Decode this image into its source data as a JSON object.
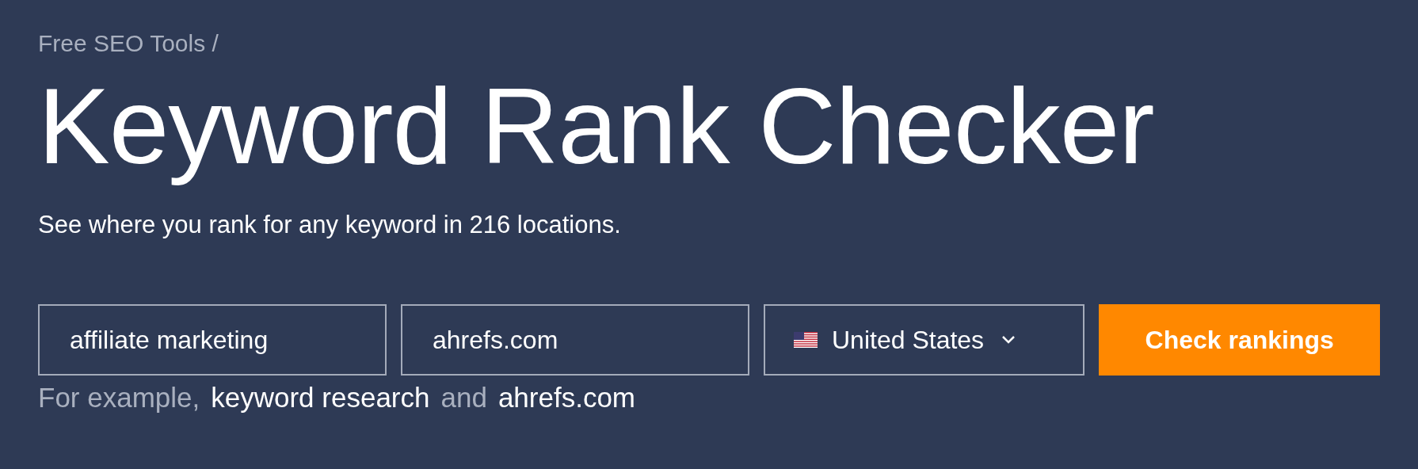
{
  "breadcrumb": "Free SEO Tools /",
  "title": "Keyword Rank Checker",
  "subtitle": "See where you rank for any keyword in 216 locations.",
  "form": {
    "keyword": {
      "value": "affiliate marketing"
    },
    "domain": {
      "value": "ahrefs.com"
    },
    "country": {
      "value": "United States"
    },
    "submit": "Check rankings"
  },
  "example": {
    "prefix": "For example,",
    "keyword_link": "keyword research",
    "joiner": "and",
    "domain_link": "ahrefs.com"
  }
}
